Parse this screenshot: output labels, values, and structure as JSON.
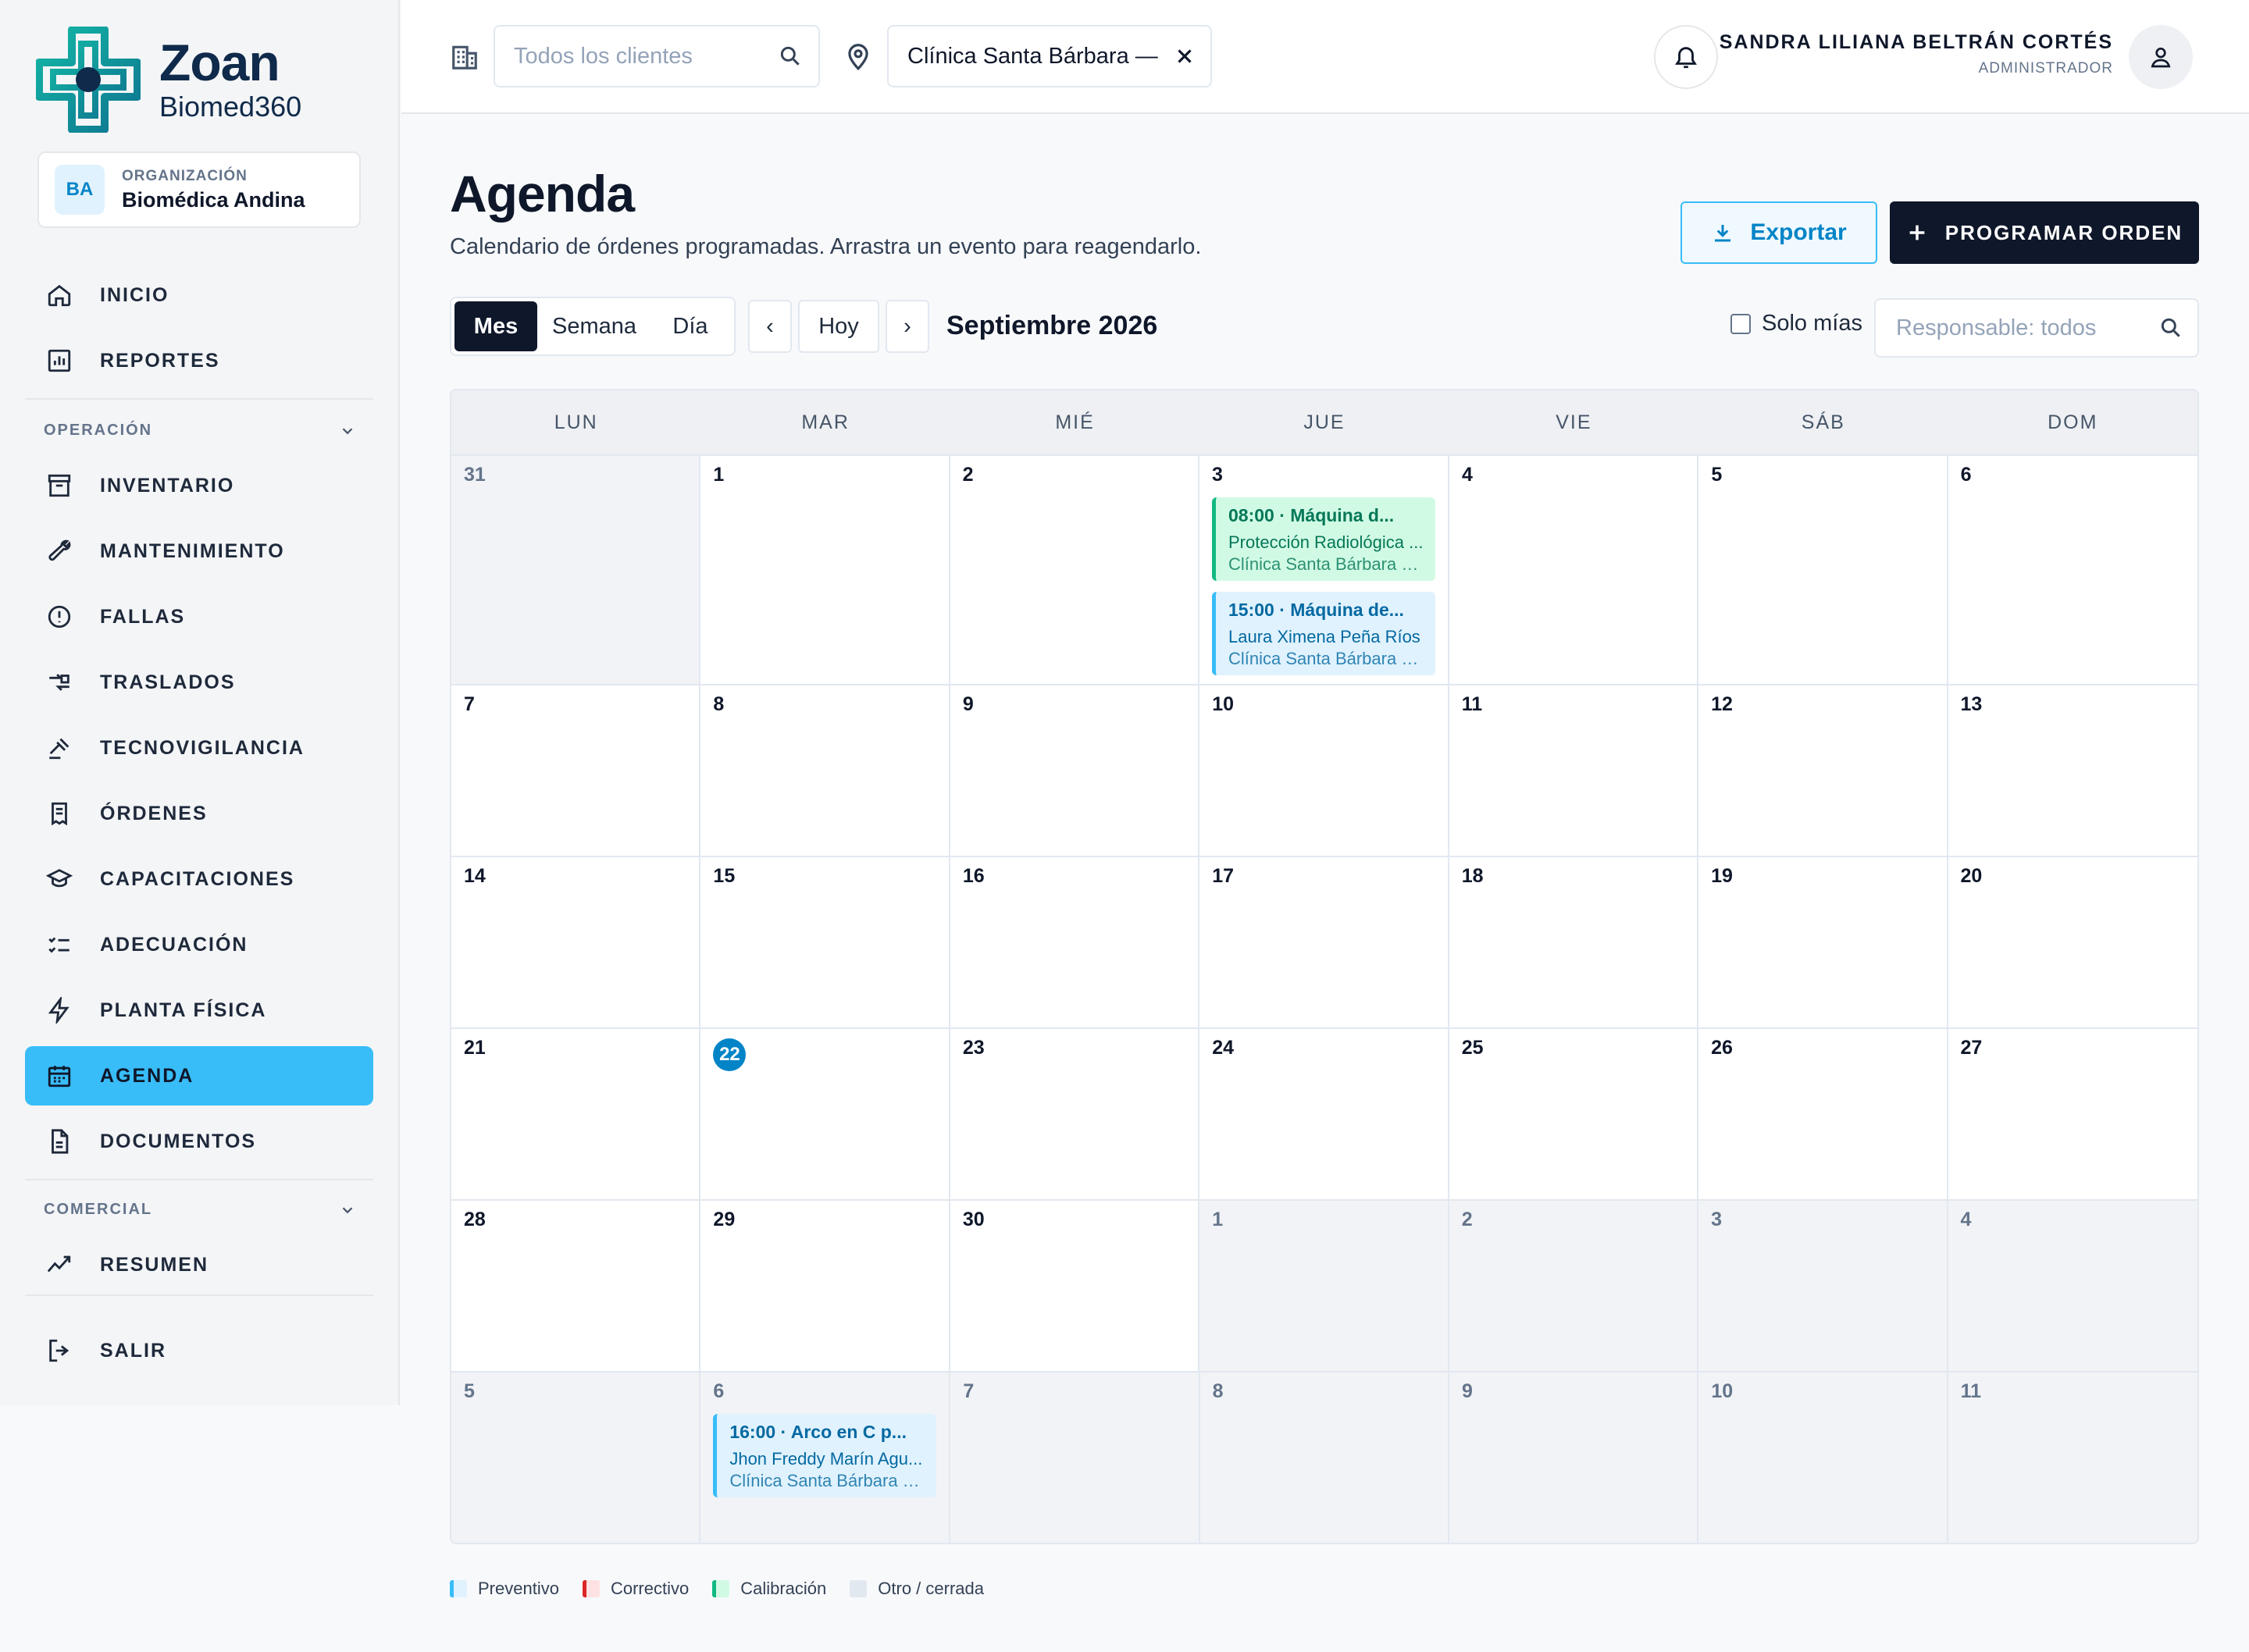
{
  "brand": {
    "name": "Zoan",
    "sub": "Biomed360"
  },
  "org": {
    "badge": "BA",
    "label": "ORGANIZACIÓN",
    "name": "Biomédica Andina"
  },
  "nav": {
    "top": [
      {
        "label": "INICIO",
        "icon": "home-icon"
      },
      {
        "label": "REPORTES",
        "icon": "chart-icon"
      }
    ],
    "section1": "OPERACIÓN",
    "ops": [
      {
        "label": "INVENTARIO",
        "icon": "archive-icon"
      },
      {
        "label": "MANTENIMIENTO",
        "icon": "wrench-icon"
      },
      {
        "label": "FALLAS",
        "icon": "alert-icon"
      },
      {
        "label": "TRASLADOS",
        "icon": "transfer-icon"
      },
      {
        "label": "TECNOVIGILANCIA",
        "icon": "gavel-icon"
      },
      {
        "label": "ÓRDENES",
        "icon": "receipt-icon"
      },
      {
        "label": "CAPACITACIONES",
        "icon": "graduation-icon"
      },
      {
        "label": "ADECUACIÓN",
        "icon": "checklist-icon"
      },
      {
        "label": "PLANTA FÍSICA",
        "icon": "bolt-icon"
      },
      {
        "label": "AGENDA",
        "icon": "calendar-icon",
        "active": true
      },
      {
        "label": "DOCUMENTOS",
        "icon": "document-icon"
      }
    ],
    "section2": "COMERCIAL",
    "com": [
      {
        "label": "RESUMEN",
        "icon": "trend-icon"
      }
    ],
    "logout": "SALIR"
  },
  "topbar": {
    "clients_placeholder": "Todos los clientes",
    "site_value": "Clínica Santa Bárbara —",
    "user_name": "SANDRA LILIANA BELTRÁN CORTÉS",
    "user_role": "ADMINISTRADOR"
  },
  "header": {
    "title": "Agenda",
    "subtitle": "Calendario de órdenes programadas. Arrastra un evento para reagendarlo.",
    "export": "Exportar",
    "schedule": "PROGRAMAR ORDEN"
  },
  "controls": {
    "views": [
      "Mes",
      "Semana",
      "Día"
    ],
    "prev": "‹",
    "today": "Hoy",
    "next": "›",
    "month": "Septiembre 2026",
    "solo_mias": "Solo mías",
    "responsable_placeholder": "Responsable: todos"
  },
  "calendar": {
    "weekdays": [
      "LUN",
      "MAR",
      "MIÉ",
      "JUE",
      "VIE",
      "SÁB",
      "DOM"
    ],
    "weeks": [
      [
        {
          "d": "31",
          "out": true
        },
        {
          "d": "1"
        },
        {
          "d": "2"
        },
        {
          "d": "3",
          "events": [
            0,
            1
          ]
        },
        {
          "d": "4"
        },
        {
          "d": "5"
        },
        {
          "d": "6"
        }
      ],
      [
        {
          "d": "7"
        },
        {
          "d": "8"
        },
        {
          "d": "9"
        },
        {
          "d": "10"
        },
        {
          "d": "11"
        },
        {
          "d": "12"
        },
        {
          "d": "13"
        }
      ],
      [
        {
          "d": "14"
        },
        {
          "d": "15"
        },
        {
          "d": "16"
        },
        {
          "d": "17"
        },
        {
          "d": "18"
        },
        {
          "d": "19"
        },
        {
          "d": "20"
        }
      ],
      [
        {
          "d": "21"
        },
        {
          "d": "22",
          "today": true
        },
        {
          "d": "23"
        },
        {
          "d": "24"
        },
        {
          "d": "25"
        },
        {
          "d": "26"
        },
        {
          "d": "27"
        }
      ],
      [
        {
          "d": "28"
        },
        {
          "d": "29"
        },
        {
          "d": "30"
        },
        {
          "d": "1",
          "out": true
        },
        {
          "d": "2",
          "out": true
        },
        {
          "d": "3",
          "out": true
        },
        {
          "d": "4",
          "out": true
        }
      ],
      [
        {
          "d": "5",
          "out": true
        },
        {
          "d": "6",
          "out": true,
          "events": [
            2
          ]
        },
        {
          "d": "7",
          "out": true
        },
        {
          "d": "8",
          "out": true
        },
        {
          "d": "9",
          "out": true
        },
        {
          "d": "10",
          "out": true
        },
        {
          "d": "11",
          "out": true
        }
      ]
    ],
    "events": [
      {
        "title": "08:00 · Máquina d...",
        "person": "Protección Radiológica ...",
        "place": "Clínica Santa Bárbara —...",
        "kind": "green"
      },
      {
        "title": "15:00 · Máquina de...",
        "person": "Laura Ximena Peña Ríos",
        "place": "Clínica Santa Bárbara —...",
        "kind": "blue"
      },
      {
        "title": "16:00 · Arco en C p...",
        "person": "Jhon Freddy Marín Agu...",
        "place": "Clínica Santa Bárbara —...",
        "kind": "blue"
      }
    ]
  },
  "legend": [
    {
      "label": "Preventivo",
      "bg": "#e0f2fe",
      "border": "#38bdf8"
    },
    {
      "label": "Correctivo",
      "bg": "#fee2e2",
      "border": "#dc2626"
    },
    {
      "label": "Calibración",
      "bg": "#d1fae5",
      "border": "#10b981"
    },
    {
      "label": "Otro / cerrada",
      "bg": "#e2e8f0",
      "border": "#e2e8f0"
    }
  ]
}
